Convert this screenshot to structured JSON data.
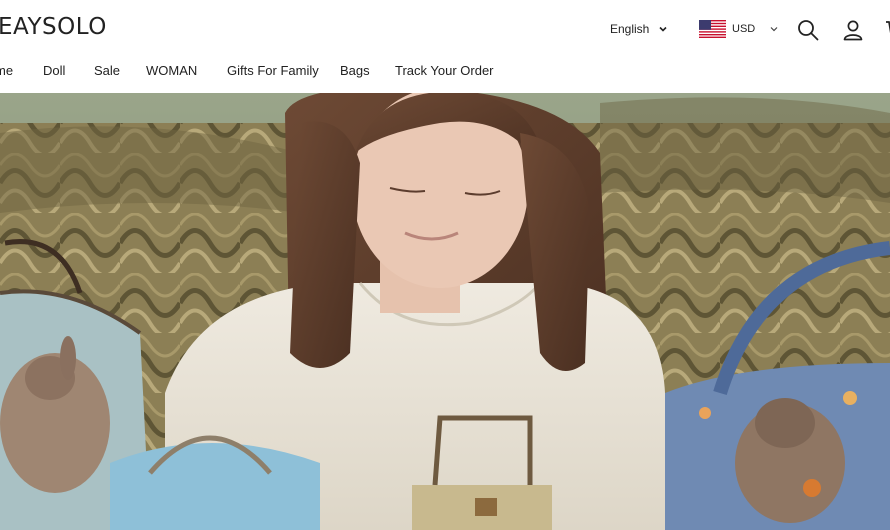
{
  "header": {
    "logo_text": "EAYSOLO",
    "language": "English",
    "currency": "USD",
    "icons": [
      "chevron-down-icon",
      "us-flag-icon",
      "search-icon",
      "user-icon",
      "cart-icon"
    ]
  },
  "nav": {
    "items": [
      {
        "label": "me"
      },
      {
        "label": "Doll"
      },
      {
        "label": "Sale"
      },
      {
        "label": "WOMAN"
      },
      {
        "label": "Gifts For Family"
      },
      {
        "label": "Bags"
      },
      {
        "label": "Track Your Order"
      }
    ]
  },
  "hero": {
    "image_subject": "woman-with-felted-bags-photo"
  },
  "colors": {
    "text": "#222222",
    "header_bg": "#ffffff",
    "sofa": "#8a7d52"
  }
}
